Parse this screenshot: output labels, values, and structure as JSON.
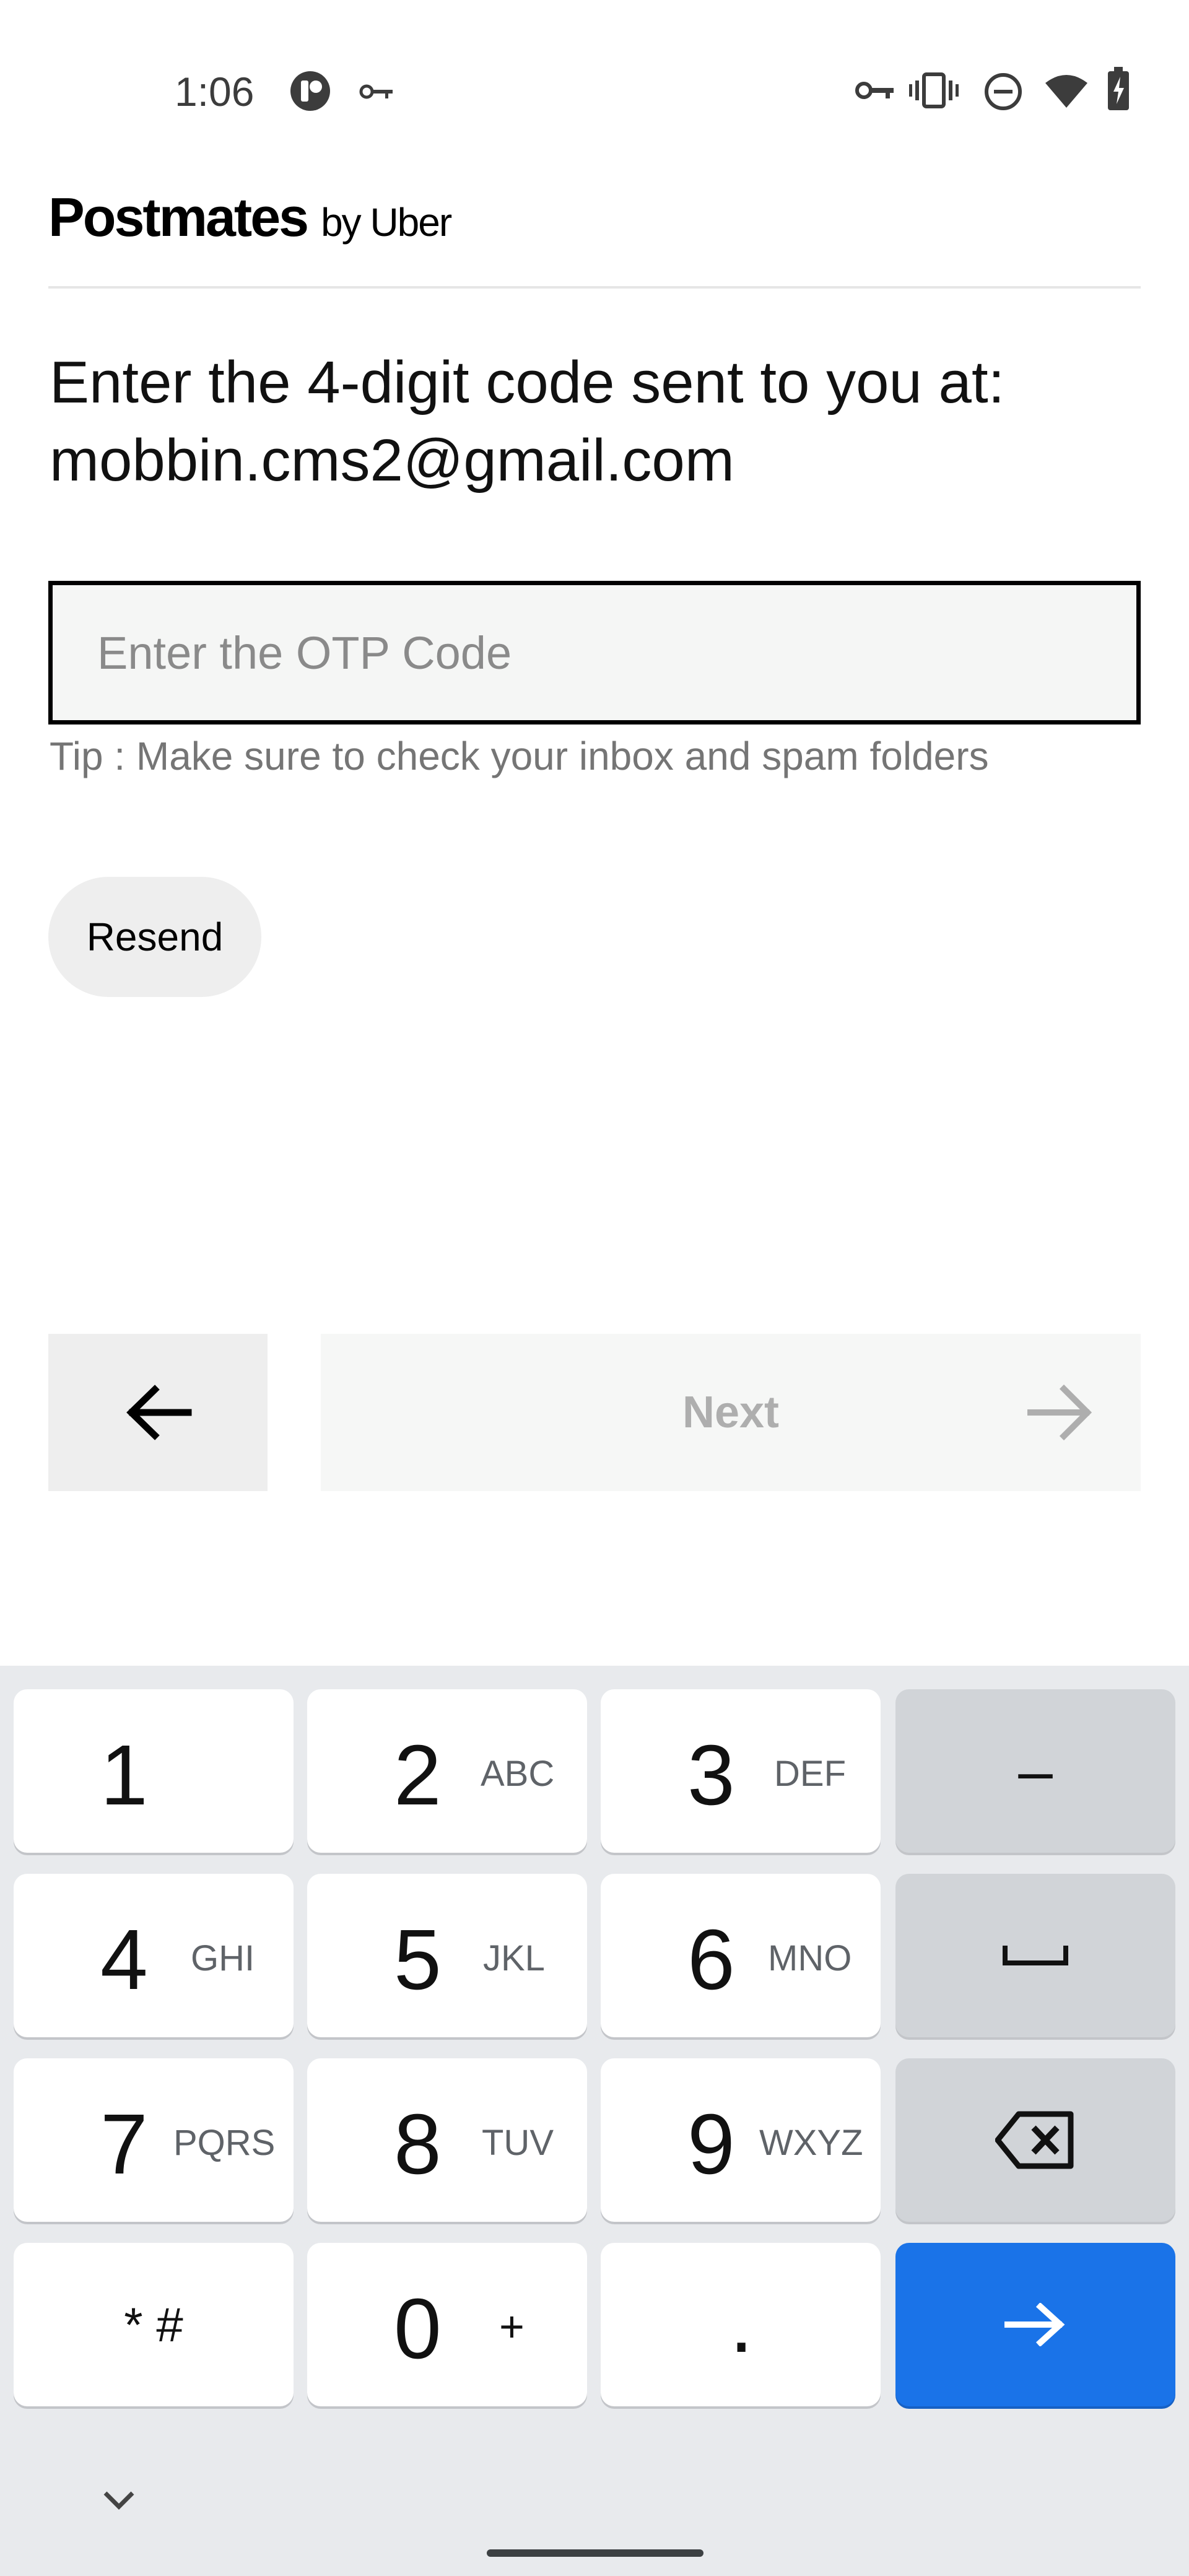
{
  "status_bar": {
    "time": "1:06",
    "left_icons": [
      "app-badge-icon",
      "vpn-key-icon"
    ],
    "right_icons": [
      "vpn-key-icon",
      "vibrate-icon",
      "do-not-disturb-icon",
      "wifi-icon",
      "battery-charging-icon"
    ]
  },
  "brand": {
    "name": "Postmates",
    "suffix": "by Uber"
  },
  "prompt": {
    "line1": "Enter the 4-digit code sent to you at:",
    "email": "mobbin.cms2@gmail.com"
  },
  "otp": {
    "value": "",
    "placeholder": "Enter the OTP Code"
  },
  "tip": "Tip : Make sure to check your inbox and spam folders",
  "resend_label": "Resend",
  "nav": {
    "back_icon": "arrow-left-icon",
    "next_label": "Next",
    "next_icon": "arrow-right-icon"
  },
  "keyboard": {
    "keys": [
      {
        "num": "1",
        "letters": ""
      },
      {
        "num": "2",
        "letters": "ABC"
      },
      {
        "num": "3",
        "letters": "DEF"
      },
      {
        "num": "4",
        "letters": "GHI"
      },
      {
        "num": "5",
        "letters": "JKL"
      },
      {
        "num": "6",
        "letters": "MNO"
      },
      {
        "num": "7",
        "letters": "PQRS"
      },
      {
        "num": "8",
        "letters": "TUV"
      },
      {
        "num": "9",
        "letters": "WXYZ"
      },
      {
        "num": "0",
        "letters": "+"
      }
    ],
    "symbols": "* #",
    "dot": ".",
    "dash": "–",
    "colors": {
      "background": "#e8eaed",
      "key": "#ffffff",
      "function_key": "#d1d4d8",
      "action_key": "#1a73e8"
    }
  }
}
